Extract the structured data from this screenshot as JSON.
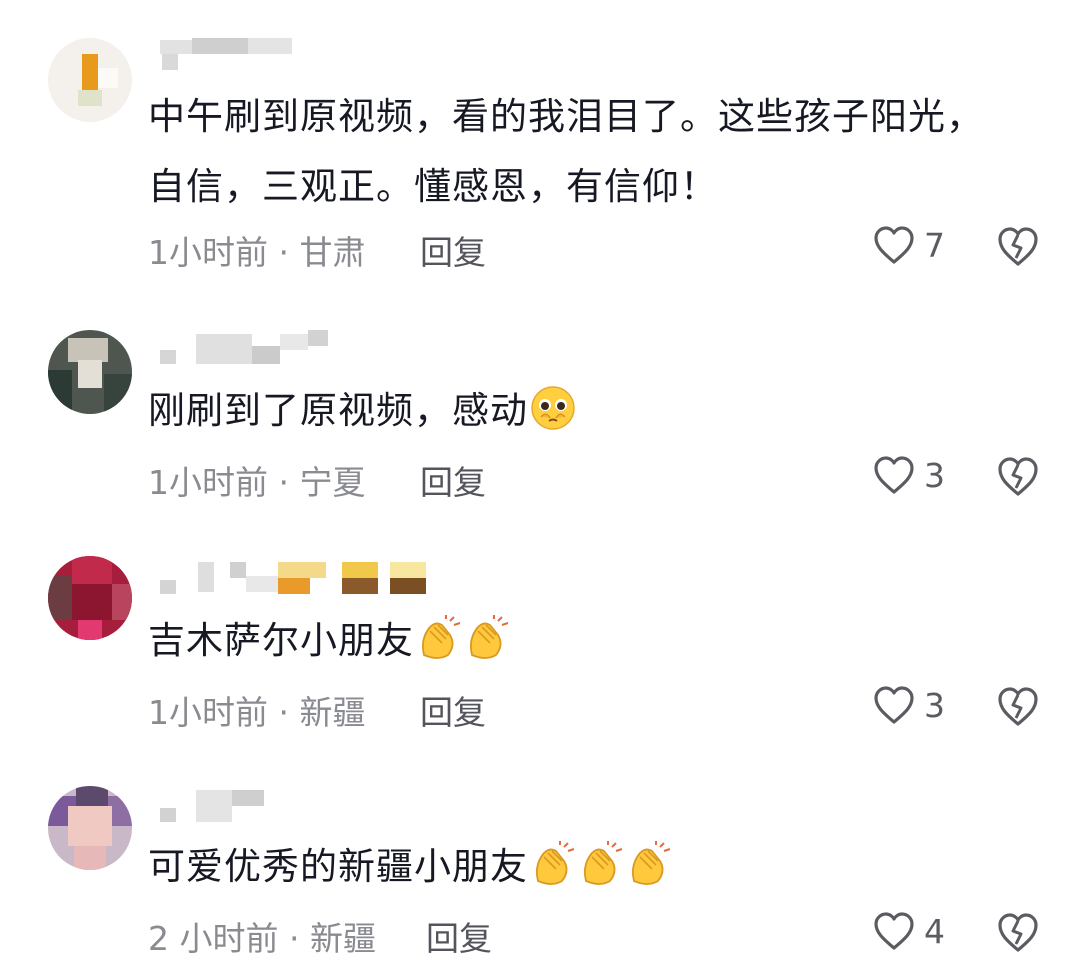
{
  "comments": [
    {
      "text": "中午刷到原视频，看的我泪目了。这些孩子阳光，自信，三观正。懂感恩，有信仰！",
      "meta": "1小时前 · 甘肃",
      "reply_label": "回复",
      "like_count": "7",
      "emojis": []
    },
    {
      "text": "刚刷到了原视频，感动",
      "meta": "1小时前 · 宁夏",
      "reply_label": "回复",
      "like_count": "3",
      "emojis": [
        "pleading-face"
      ]
    },
    {
      "text": "吉木萨尔小朋友",
      "meta": "1小时前 · 新疆",
      "reply_label": "回复",
      "like_count": "3",
      "emojis": [
        "clapping-hands",
        "clapping-hands"
      ]
    },
    {
      "text": "可爱优秀的新疆小朋友",
      "meta": "2 小时前 · 新疆",
      "reply_label": "回复",
      "like_count": "4",
      "emojis": [
        "clapping-hands",
        "clapping-hands",
        "clapping-hands"
      ]
    }
  ],
  "icons": {
    "like": "heart-outline-icon",
    "dislike": "broken-heart-icon"
  },
  "colors": {
    "text": "#161823",
    "meta": "#8a8b91",
    "icon": "#5b5c62"
  }
}
